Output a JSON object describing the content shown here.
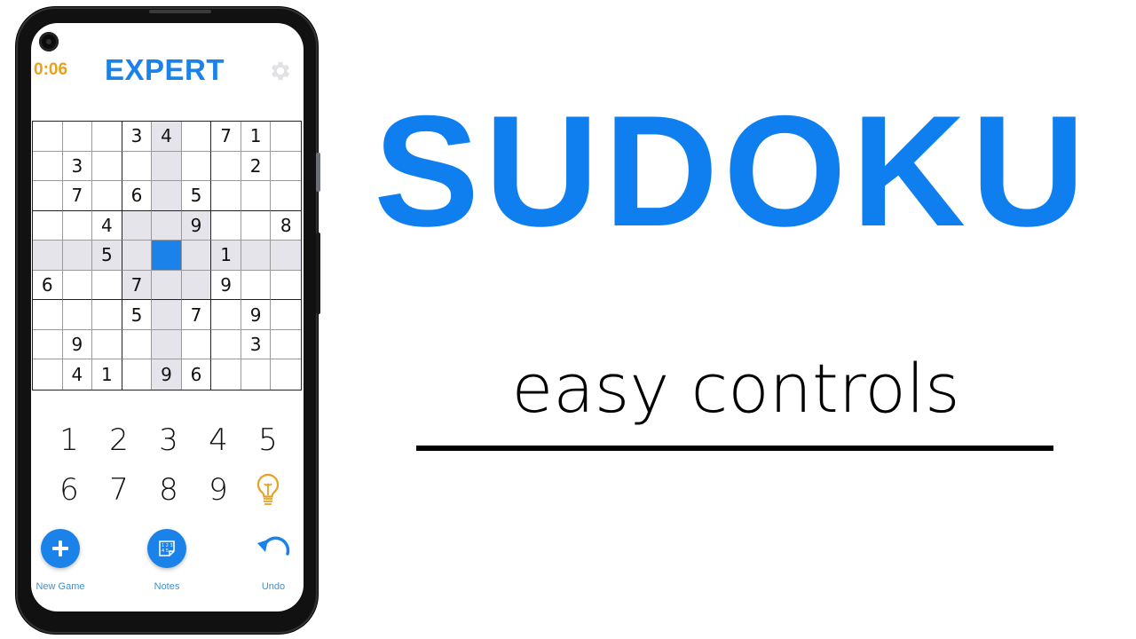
{
  "phone": {
    "timer": "0:06",
    "difficulty": "EXPERT",
    "settings_icon": "gear-icon",
    "grid": [
      [
        "",
        "",
        "",
        "3",
        "4",
        "",
        "7",
        "1",
        ""
      ],
      [
        "",
        "3",
        "",
        "",
        "",
        "",
        "",
        "2",
        ""
      ],
      [
        "",
        "7",
        "",
        "6",
        "",
        "5",
        "",
        "",
        ""
      ],
      [
        "",
        "",
        "4",
        "",
        "",
        "9",
        "",
        "",
        "8"
      ],
      [
        "",
        "",
        "5",
        "",
        "",
        "",
        "1",
        "",
        ""
      ],
      [
        "6",
        "",
        "",
        "7",
        "",
        "",
        "9",
        "",
        ""
      ],
      [
        "",
        "",
        "",
        "5",
        "",
        "7",
        "",
        "9",
        ""
      ],
      [
        "",
        "9",
        "",
        "",
        "",
        "",
        "",
        "3",
        ""
      ],
      [
        "",
        "4",
        "1",
        "",
        "9",
        "6",
        "",
        "",
        ""
      ]
    ],
    "selected_cell": {
      "row": 4,
      "col": 4
    },
    "numpad": [
      "1",
      "2",
      "3",
      "4",
      "5",
      "6",
      "7",
      "8",
      "9"
    ],
    "hint_icon": "lightbulb-icon",
    "actions": {
      "new_game": {
        "label": "New Game",
        "icon": "plus-icon"
      },
      "notes": {
        "label": "Notes",
        "icon": "notes-icon"
      },
      "undo": {
        "label": "Undo",
        "icon": "undo-icon"
      }
    }
  },
  "promo": {
    "title": "SUDOKU",
    "subtitle": "easy controls"
  },
  "colors": {
    "accent": "#1a82e8",
    "timer": "#e8a020",
    "highlight": "#e4e4ea",
    "title": "#0f7ff0"
  }
}
